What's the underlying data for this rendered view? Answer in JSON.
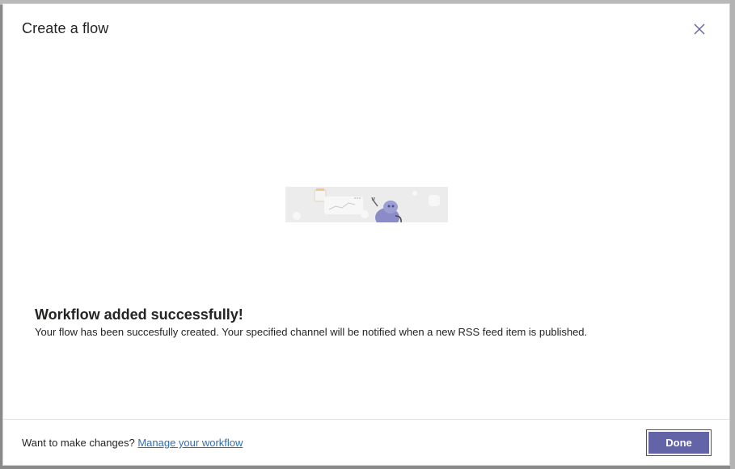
{
  "dialog": {
    "title": "Create a flow",
    "close_icon": "close-icon"
  },
  "illustration": {
    "icon": "bot-waving-illustration",
    "accent": "#8b8cc7"
  },
  "result": {
    "title": "Workflow added successfully!",
    "message": "Your flow has been succesfully created. Your specified channel will be notified when a new RSS feed item is published."
  },
  "footer": {
    "prompt": "Want to make changes?",
    "link_label": "Manage your workflow",
    "done_label": "Done"
  },
  "colors": {
    "primary": "#6264a7",
    "link": "#2f6eb5",
    "text": "#252423"
  }
}
